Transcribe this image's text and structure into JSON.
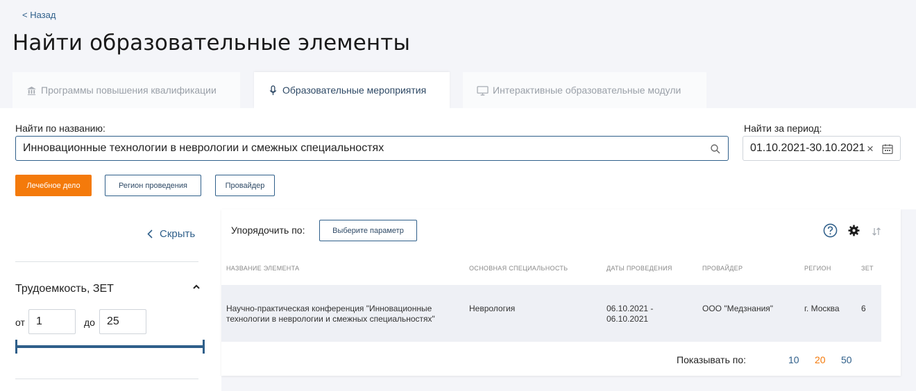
{
  "back_label": "< Назад",
  "page_title": "Найти образовательные элементы",
  "tabs": [
    {
      "label": "Программы повышения квалификации",
      "icon": "institution-icon"
    },
    {
      "label": "Образовательные мероприятия",
      "icon": "microphone-icon"
    },
    {
      "label": "Интерактивные образовательные модули",
      "icon": "monitor-icon"
    }
  ],
  "search": {
    "label": "Найти по названию:",
    "value": "Инновационные технологии в неврологии и смежных специальностях"
  },
  "period": {
    "label": "Найти за период:",
    "value": "01.10.2021-30.10.2021",
    "clear": "×"
  },
  "filter_chips": [
    {
      "label": "Лечебное дело"
    },
    {
      "label": "Регион проведения"
    },
    {
      "label": "Провайдер"
    }
  ],
  "sidebar": {
    "hide_label": "Скрыть",
    "filter_title": "Трудоемкость, ЗЕТ",
    "from_label": "от",
    "from_value": "1",
    "to_label": "до",
    "to_value": "25"
  },
  "sort": {
    "label": "Упорядочить по:",
    "button": "Выберите параметр"
  },
  "table": {
    "headers": [
      "Название элемента",
      "Основная специальность",
      "Даты проведения",
      "Провайдер",
      "Регион",
      "ЗЕТ"
    ],
    "rows": [
      {
        "name": "Научно-практическая конференция \"Инновационные технологии в неврологии и смежных специальностях\"",
        "specialty": "Неврология",
        "dates": "06.10.2021 - 06.10.2021",
        "provider": "ООО \"Медзнания\"",
        "region": "г. Москва",
        "zet": "6"
      }
    ]
  },
  "pagination": {
    "label": "Показывать по:",
    "options": [
      "10",
      "20",
      "50"
    ],
    "selected": "20"
  },
  "colors": {
    "accent": "#f47a0b",
    "primary": "#2f5f8a"
  }
}
